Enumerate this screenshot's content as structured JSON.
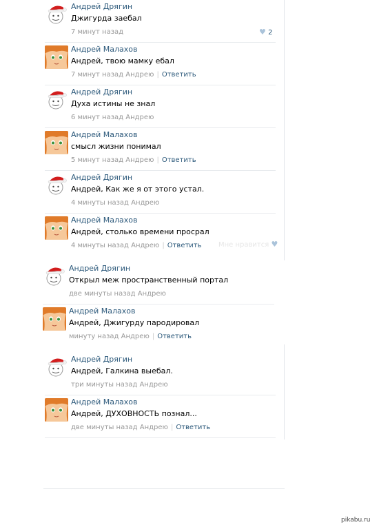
{
  "comments": [
    {
      "author": "Андрей Дрягин",
      "text": "Джигурда заебал",
      "time": "7 минут назад",
      "to": "",
      "reply": "",
      "likes": "2"
    },
    {
      "author": "Андрей Малахов",
      "text": "Андрей, твою мамку ебал",
      "time": "7 минут назад Андрею",
      "to": "",
      "reply": "Ответить"
    },
    {
      "author": "Андрей Дрягин",
      "text": "Духа истины не знал",
      "time": "6 минут назад Андрею"
    },
    {
      "author": "Андрей Малахов",
      "text": "смысл жизни понимал",
      "time": "5 минут назад Андрею",
      "reply": "Ответить"
    },
    {
      "author": "Андрей Дрягин",
      "text": "Андрей, Как же я от этого устал.",
      "time": "4 минуты назад Андрею"
    },
    {
      "author": "Андрей Малахов",
      "text": "Андрей, столько времени просрал",
      "time": "4 минуты назад Андрею",
      "reply": "Ответить",
      "like_label": "Мне нравится"
    },
    {
      "author": "Андрей Дрягин",
      "text": "Открыл меж пространственный портал",
      "time": "две минуты назад Андрею"
    },
    {
      "author": "Андрей Малахов",
      "text": "Андрей, Джигурду пародировал",
      "time": "минуту назад Андрею",
      "reply": "Ответить"
    },
    {
      "author": "Андрей Дрягин",
      "text": "Андрей, Галкина выебал.",
      "time": "три минуты назад Андрею"
    },
    {
      "author": "Андрей Малахов",
      "text": "Андрей, ДУХОВНОСТЬ познал...",
      "time": "две минуты назад Андрею",
      "reply": "Ответить"
    }
  ],
  "avatars": {
    "dryagin": "santa-hat-face-icon",
    "malakhov": "anime-girl-icon"
  },
  "colors": {
    "link": "#2b587a",
    "meta": "#999999",
    "divider": "#e8ebee",
    "heart": "#aac3da"
  },
  "watermark": "pikabu.ru"
}
